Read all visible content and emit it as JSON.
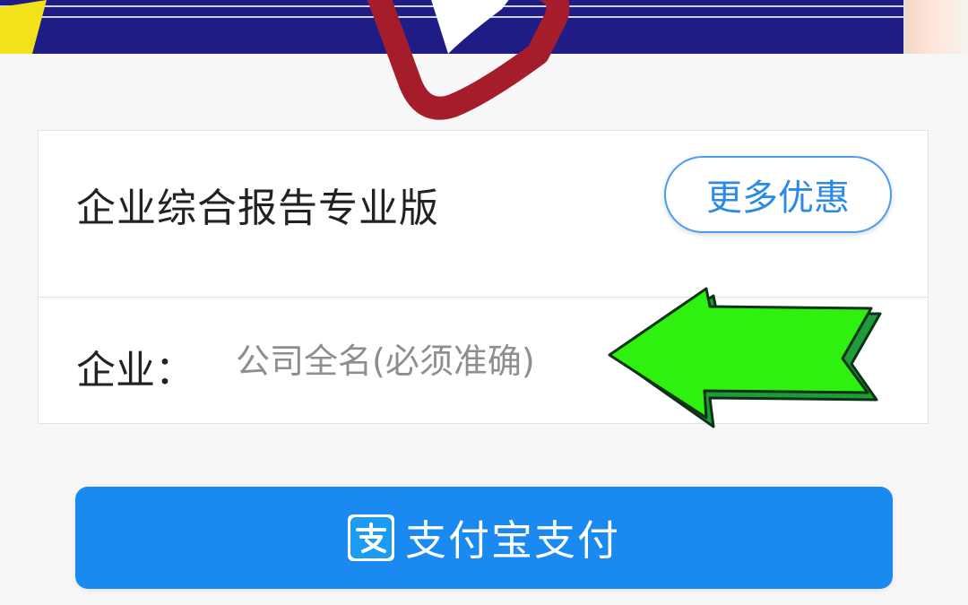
{
  "product": {
    "title": "企业综合报告专业版",
    "more_offers_label": "更多优惠"
  },
  "company": {
    "label": "企业：",
    "input_value": "",
    "placeholder": "公司全名(必须准确)"
  },
  "payment": {
    "button_label": "支付宝支付",
    "icon_name": "alipay-icon"
  },
  "colors": {
    "banner": "#1f1c86",
    "primary_blue": "#1a8af0",
    "annotation_red": "#a51c2a",
    "annotation_green": "#22ee11"
  }
}
